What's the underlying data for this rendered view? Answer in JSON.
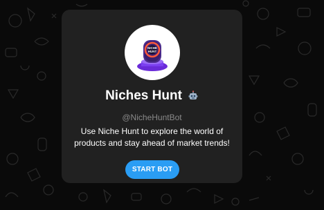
{
  "bot": {
    "name": "Niches Hunt",
    "username": "@NicheHuntBot",
    "description": "Use Niche Hunt to explore the world of products and stay ahead of market trends!",
    "badge_icon": "robot-icon",
    "avatar_text_line1": "NICHE",
    "avatar_text_line2": "HUNT"
  },
  "actions": {
    "start_label": "START BOT"
  },
  "colors": {
    "background": "#0a0a0a",
    "card": "#212121",
    "accent": "#2a9df4",
    "muted_text": "#8a8a8a"
  }
}
